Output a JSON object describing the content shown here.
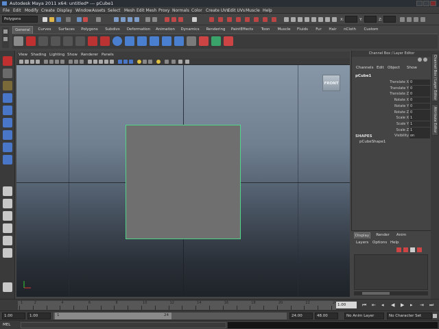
{
  "window": {
    "title": "Autodesk Maya 2011 x64: untitled*   ---   pCube1"
  },
  "menus": [
    "File",
    "Edit",
    "Modify",
    "Create",
    "Display",
    "Window",
    "Assets",
    "Select",
    "Mesh",
    "Edit Mesh",
    "Proxy",
    "Normals",
    "Color",
    "Create UVs",
    "Edit UVs",
    "Muscle",
    "Help"
  ],
  "statusline": {
    "mode": "Polygons",
    "x_label": "X:",
    "y_label": "Y:",
    "z_label": "Z:"
  },
  "shelf_tabs": [
    "General",
    "Curves",
    "Surfaces",
    "Polygons",
    "Subdivs",
    "Deformation",
    "Animation",
    "Dynamics",
    "Rendering",
    "PaintEffects",
    "Toon",
    "Muscle",
    "Fluids",
    "Fur",
    "Hair",
    "nCloth",
    "Custom"
  ],
  "panel": {
    "menus": [
      "View",
      "Shading",
      "Lighting",
      "Show",
      "Renderer",
      "Panels"
    ],
    "viewcube_label": "FRONT"
  },
  "channelbox": {
    "header": "Channel Box / Layer Editor",
    "menus": [
      "Channels",
      "Edit",
      "Object",
      "Show"
    ],
    "object": "pCube1",
    "attributes": [
      {
        "label": "Translate X",
        "value": "0"
      },
      {
        "label": "Translate Y",
        "value": "0"
      },
      {
        "label": "Translate Z",
        "value": "0"
      },
      {
        "label": "Rotate X",
        "value": "0"
      },
      {
        "label": "Rotate Y",
        "value": "0"
      },
      {
        "label": "Rotate Z",
        "value": "0"
      },
      {
        "label": "Scale X",
        "value": "1"
      },
      {
        "label": "Scale Y",
        "value": "1"
      },
      {
        "label": "Scale Z",
        "value": "1"
      },
      {
        "label": "Visibility",
        "value": "on"
      }
    ],
    "shapes_header": "SHAPES",
    "shape_name": "pCubeShape1"
  },
  "side_tabs": [
    "Channel Box / Layer Editor",
    "Attribute Editor"
  ],
  "layer_editor": {
    "tabs": [
      "Display",
      "Render",
      "Anim"
    ],
    "menus": [
      "Layers",
      "Options",
      "Help"
    ]
  },
  "timeslider": {
    "ticks": [
      "1",
      "2",
      "4",
      "6",
      "8",
      "10",
      "12",
      "14",
      "16",
      "18",
      "20",
      "22",
      "24"
    ],
    "current_frame": "1.00"
  },
  "rangeslider": {
    "start": "1.00",
    "inner_start": "1.00",
    "range_start": "1",
    "range_end": "24",
    "inner_end": "24.00",
    "end": "48.00",
    "anim_layer": "No Anim Layer",
    "char_set": "No Character Set"
  },
  "cmdline": {
    "label": "MEL"
  },
  "colors": {
    "accent_red": "#c03030",
    "selection_green": "#52d78a"
  }
}
